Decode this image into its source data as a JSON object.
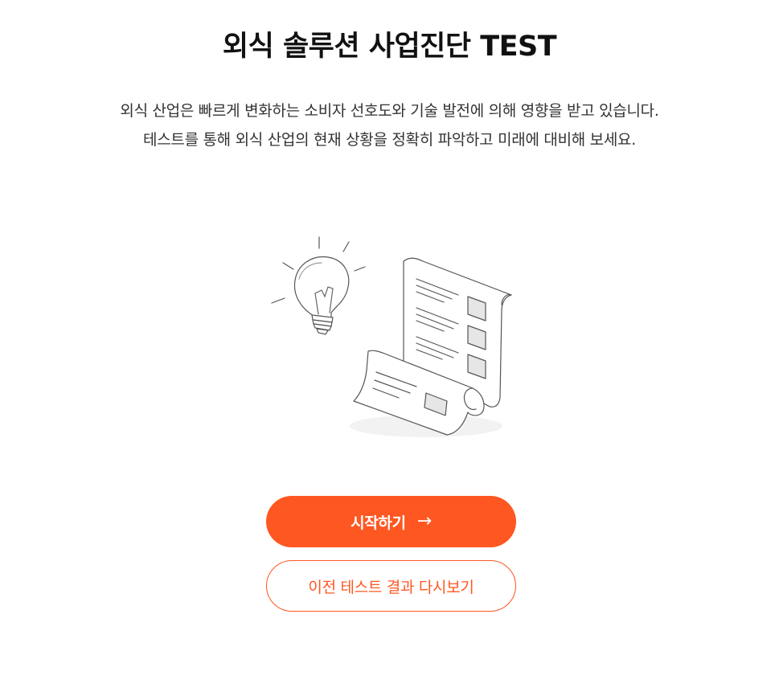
{
  "title": "외식 솔루션 사업진단 TEST",
  "description": {
    "line1": "외식 산업은 빠르게 변화하는 소비자 선호도와 기술 발전에 의해 영향을 받고 있습니다.",
    "line2": "테스트를 통해 외식 산업의 현재 상황을 정확히 파악하고 미래에 대비해 보세요."
  },
  "buttons": {
    "start_label": "시작하기",
    "start_arrow": "→",
    "previous_results_label": "이전 테스트 결과 다시보기"
  },
  "colors": {
    "accent": "#ff5722",
    "text": "#222222"
  },
  "illustration": {
    "icons": [
      "lightbulb-icon",
      "document-checklist-icon"
    ]
  }
}
